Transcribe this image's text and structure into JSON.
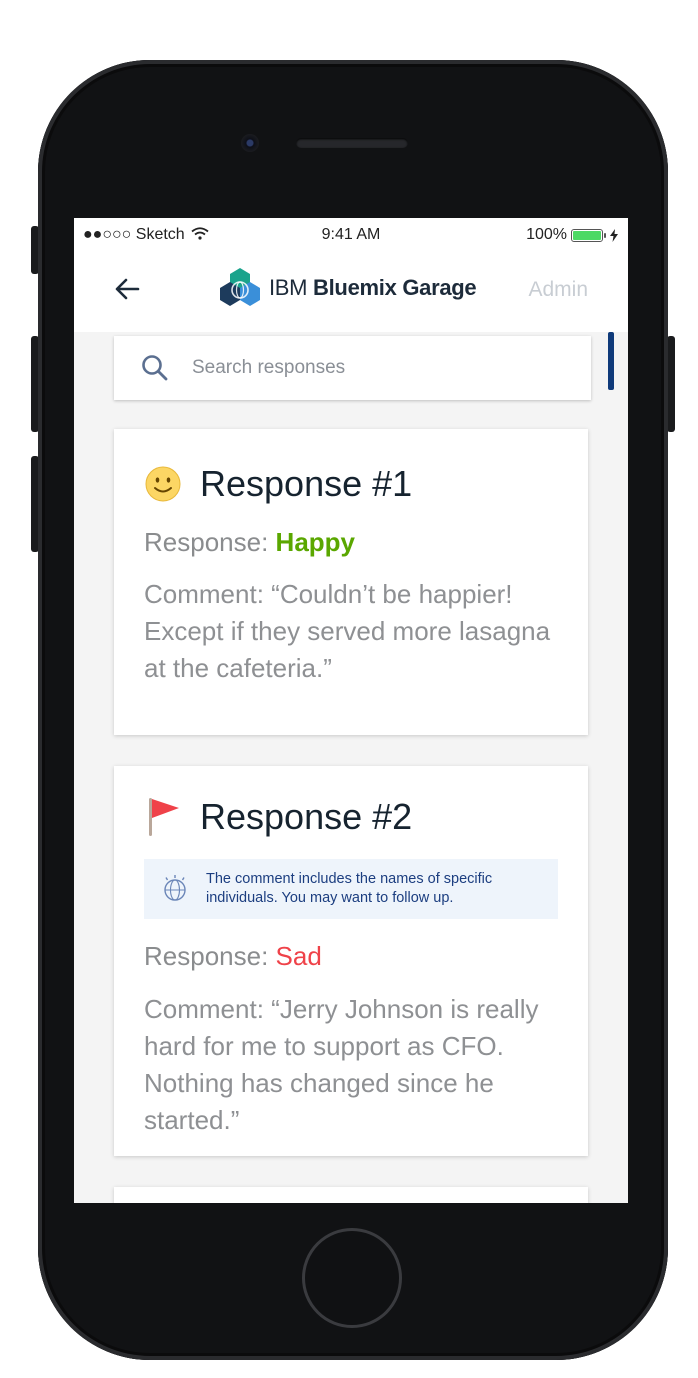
{
  "status_bar": {
    "carrier": "●●○○○ Sketch",
    "time": "9:41 AM",
    "battery": "100%"
  },
  "header": {
    "logo_ibm": "IBM",
    "logo_brand": "Bluemix Garage",
    "admin_label": "Admin"
  },
  "search": {
    "placeholder": "Search responses"
  },
  "responses": [
    {
      "title": "Response #1",
      "icon": "smiley-icon",
      "response_label": "Response:",
      "response_value": "Happy",
      "comment_label": "Comment:",
      "comment": "“Couldn’t be happier! Except if they served more lasagna at the cafeteria.”"
    },
    {
      "title": "Response #2",
      "icon": "red-flag-icon",
      "alert": "The comment includes the names of specific individuals. You may want to follow up.",
      "response_label": "Response:",
      "response_value": "Sad",
      "comment_label": "Comment:",
      "comment": "“Jerry Johnson is really hard for me to support as CFO. Nothing has changed since he started.”"
    }
  ],
  "colors": {
    "happy": "#5aa700",
    "sad": "#ef4249",
    "accent": "#0f3a7a"
  }
}
